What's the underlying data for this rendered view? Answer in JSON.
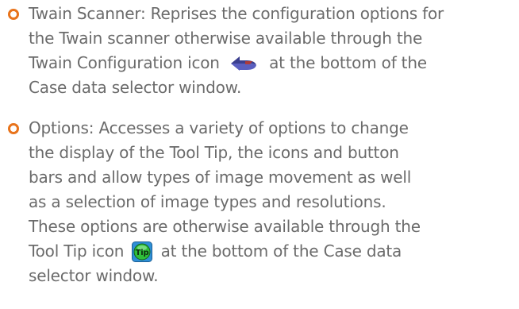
{
  "items": [
    {
      "lines": [
        "Twain Scanner: Reprises the configuration options for",
        "the Twain scanner otherwise available through the",
        "Twain Configuration icon",
        "at the bottom of the",
        "Case data selector window."
      ],
      "icon": "twain-configuration-icon"
    },
    {
      "lines": [
        "Options: Accesses a variety of options to change",
        "the display of the Tool Tip, the icons and button",
        "bars and allow types of image movement as well",
        "as a selection of image types and resolutions.",
        "These options are otherwise available through the",
        "Tool Tip icon",
        "at the bottom of the Case data",
        "selector window."
      ],
      "icon": "tool-tip-icon"
    }
  ],
  "colors": {
    "bullet": "#e8731b",
    "text": "#6b6b6b",
    "twain_icon_dark": "#3b3f8f",
    "twain_icon_accent": "#c0392b",
    "tip_icon_bg": "#2e8fd6",
    "tip_icon_face": "#2fbf3a"
  }
}
